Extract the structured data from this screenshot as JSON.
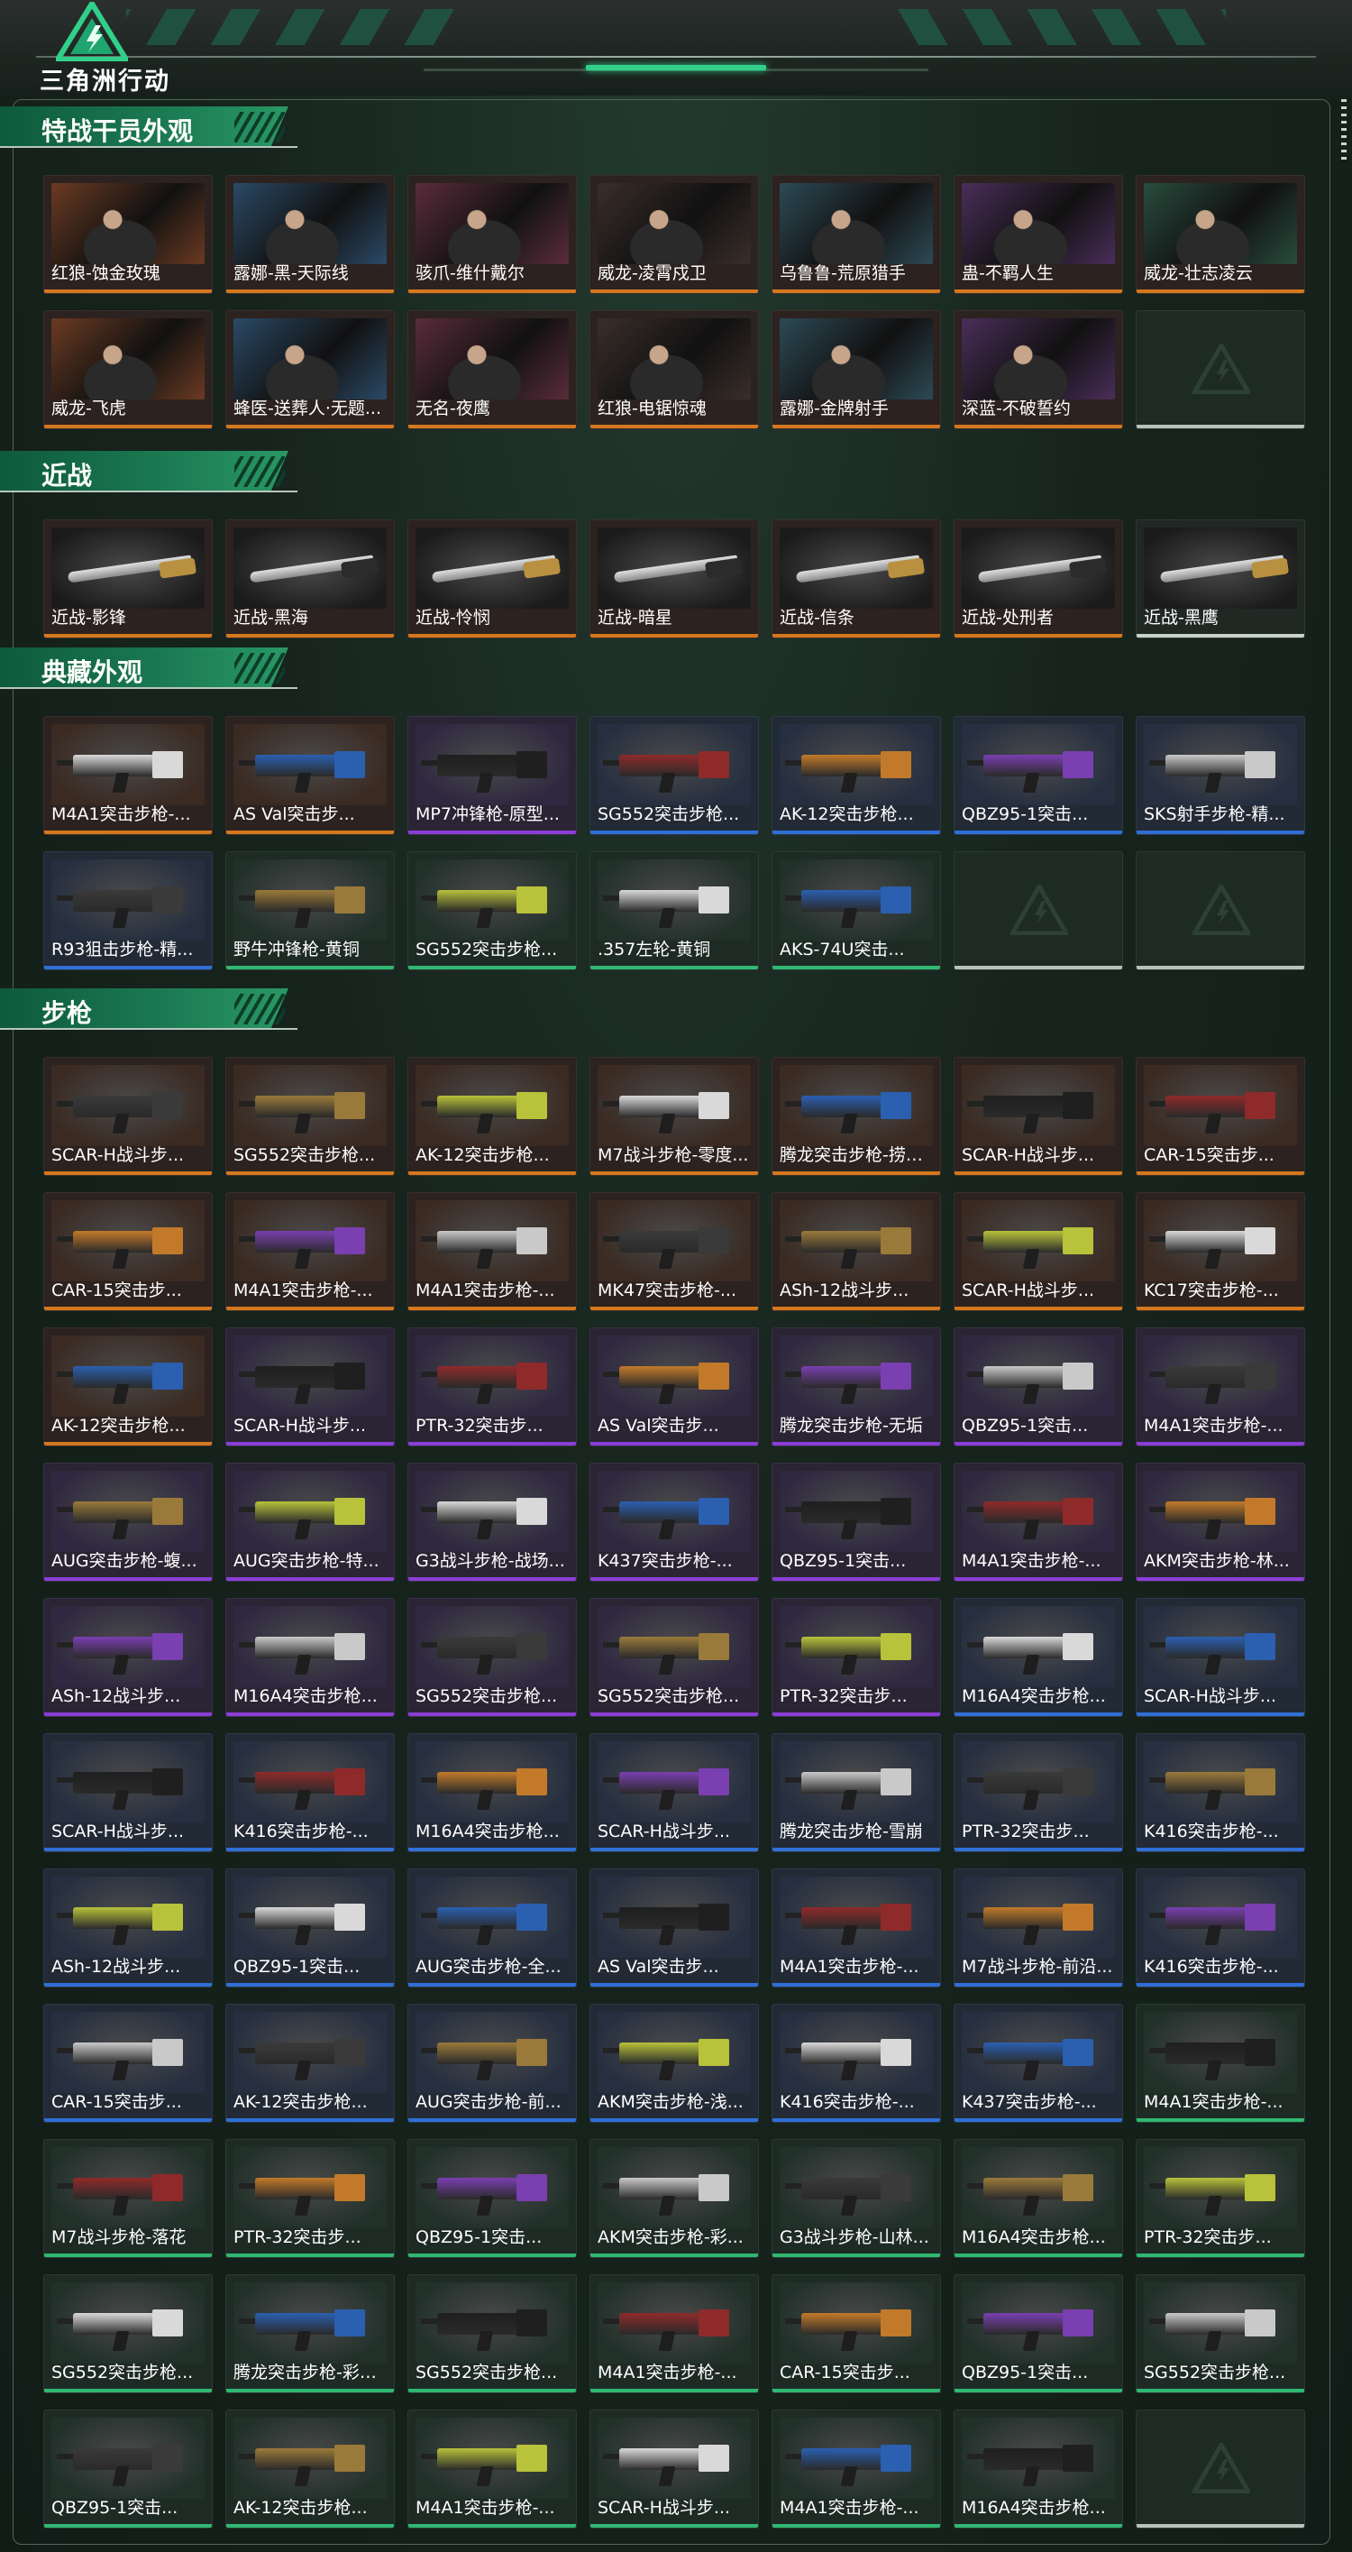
{
  "header": {
    "logo_text": "三角洲行动"
  },
  "colors": {
    "gold": "#d4781e",
    "purple": "#8a3ed6",
    "blue": "#2f6fd6",
    "green": "#2fb872",
    "white": "#c9d2cc",
    "accent": "#31d08a"
  },
  "sections": [
    {
      "title": "特战干员外观",
      "items": [
        {
          "label": "红狼-蚀金玫瑰",
          "tier": "gold"
        },
        {
          "label": "露娜-黑-天际线",
          "tier": "gold"
        },
        {
          "label": "骇爪-维什戴尔",
          "tier": "gold"
        },
        {
          "label": "威龙-凌霄戍卫",
          "tier": "gold"
        },
        {
          "label": "乌鲁鲁-荒原猎手",
          "tier": "gold"
        },
        {
          "label": "蛊-不羁人生",
          "tier": "gold"
        },
        {
          "label": "威龙-壮志凌云",
          "tier": "gold"
        },
        {
          "label": "威龙-飞虎",
          "tier": "gold"
        },
        {
          "label": "蜂医-送葬人·无题...",
          "tier": "gold"
        },
        {
          "label": "无名-夜鹰",
          "tier": "gold"
        },
        {
          "label": "红狼-电锯惊魂",
          "tier": "gold"
        },
        {
          "label": "露娜-金牌射手",
          "tier": "gold"
        },
        {
          "label": "深蓝-不破誓约",
          "tier": "gold"
        },
        {
          "label": "",
          "tier": "empty"
        }
      ]
    },
    {
      "title": "近战",
      "items": [
        {
          "label": "近战-影锋",
          "tier": "gold"
        },
        {
          "label": "近战-黑海",
          "tier": "gold"
        },
        {
          "label": "近战-怜悯",
          "tier": "gold"
        },
        {
          "label": "近战-暗星",
          "tier": "gold"
        },
        {
          "label": "近战-信条",
          "tier": "gold"
        },
        {
          "label": "近战-处刑者",
          "tier": "gold"
        },
        {
          "label": "近战-黑鹰",
          "tier": "white"
        }
      ]
    },
    {
      "title": "典藏外观",
      "items": [
        {
          "label": "M4A1突击步枪-...",
          "tier": "gold"
        },
        {
          "label": "AS Val突击步...",
          "tier": "gold"
        },
        {
          "label": "MP7冲锋枪-原型...",
          "tier": "purple"
        },
        {
          "label": "SG552突击步枪...",
          "tier": "blue"
        },
        {
          "label": "AK-12突击步枪...",
          "tier": "blue"
        },
        {
          "label": "QBZ95-1突击...",
          "tier": "blue"
        },
        {
          "label": "SKS射手步枪-精...",
          "tier": "blue"
        },
        {
          "label": "R93狙击步枪-精...",
          "tier": "blue"
        },
        {
          "label": "野牛冲锋枪-黄铜",
          "tier": "green"
        },
        {
          "label": "SG552突击步枪...",
          "tier": "green"
        },
        {
          "label": ".357左轮-黄铜",
          "tier": "green"
        },
        {
          "label": "AKS-74U突击...",
          "tier": "green"
        },
        {
          "label": "",
          "tier": "empty"
        },
        {
          "label": "",
          "tier": "empty"
        }
      ]
    },
    {
      "title": "步枪",
      "items": [
        {
          "label": "SCAR-H战斗步...",
          "tier": "gold"
        },
        {
          "label": "SG552突击步枪...",
          "tier": "gold"
        },
        {
          "label": "AK-12突击步枪...",
          "tier": "gold"
        },
        {
          "label": "M7战斗步枪-零度...",
          "tier": "gold"
        },
        {
          "label": "腾龙突击步枪-捞点...",
          "tier": "gold"
        },
        {
          "label": "SCAR-H战斗步...",
          "tier": "gold"
        },
        {
          "label": "CAR-15突击步...",
          "tier": "gold"
        },
        {
          "label": "CAR-15突击步...",
          "tier": "gold"
        },
        {
          "label": "M4A1突击步枪-...",
          "tier": "gold"
        },
        {
          "label": "M4A1突击步枪-...",
          "tier": "gold"
        },
        {
          "label": "MK47突击步枪-...",
          "tier": "gold"
        },
        {
          "label": "ASh-12战斗步...",
          "tier": "gold"
        },
        {
          "label": "SCAR-H战斗步...",
          "tier": "gold"
        },
        {
          "label": "KC17突击步枪-...",
          "tier": "gold"
        },
        {
          "label": "AK-12突击步枪...",
          "tier": "gold"
        },
        {
          "label": "SCAR-H战斗步...",
          "tier": "purple"
        },
        {
          "label": "PTR-32突击步...",
          "tier": "purple"
        },
        {
          "label": "AS Val突击步...",
          "tier": "purple"
        },
        {
          "label": "腾龙突击步枪-无垢",
          "tier": "purple"
        },
        {
          "label": "QBZ95-1突击...",
          "tier": "purple"
        },
        {
          "label": "M4A1突击步枪-...",
          "tier": "purple"
        },
        {
          "label": "AUG突击步枪-蝮...",
          "tier": "purple"
        },
        {
          "label": "AUG突击步枪-特...",
          "tier": "purple"
        },
        {
          "label": "G3战斗步枪-战场...",
          "tier": "purple"
        },
        {
          "label": "K437突击步枪-...",
          "tier": "purple"
        },
        {
          "label": "QBZ95-1突击...",
          "tier": "purple"
        },
        {
          "label": "M4A1突击步枪-...",
          "tier": "purple"
        },
        {
          "label": "AKM突击步枪-林...",
          "tier": "purple"
        },
        {
          "label": "ASh-12战斗步...",
          "tier": "purple"
        },
        {
          "label": "M16A4突击步枪...",
          "tier": "purple"
        },
        {
          "label": "SG552突击步枪...",
          "tier": "purple"
        },
        {
          "label": "SG552突击步枪...",
          "tier": "purple"
        },
        {
          "label": "PTR-32突击步...",
          "tier": "purple"
        },
        {
          "label": "M16A4突击步枪...",
          "tier": "blue"
        },
        {
          "label": "SCAR-H战斗步...",
          "tier": "blue"
        },
        {
          "label": "SCAR-H战斗步...",
          "tier": "blue"
        },
        {
          "label": "K416突击步枪-...",
          "tier": "blue"
        },
        {
          "label": "M16A4突击步枪...",
          "tier": "blue"
        },
        {
          "label": "SCAR-H战斗步...",
          "tier": "blue"
        },
        {
          "label": "腾龙突击步枪-雪崩",
          "tier": "blue"
        },
        {
          "label": "PTR-32突击步...",
          "tier": "blue"
        },
        {
          "label": "K416突击步枪-...",
          "tier": "blue"
        },
        {
          "label": "ASh-12战斗步...",
          "tier": "blue"
        },
        {
          "label": "QBZ95-1突击...",
          "tier": "blue"
        },
        {
          "label": "AUG突击步枪-全...",
          "tier": "blue"
        },
        {
          "label": "AS Val突击步...",
          "tier": "blue"
        },
        {
          "label": "M4A1突击步枪-...",
          "tier": "blue"
        },
        {
          "label": "M7战斗步枪-前沿...",
          "tier": "blue"
        },
        {
          "label": "K416突击步枪-...",
          "tier": "blue"
        },
        {
          "label": "CAR-15突击步...",
          "tier": "blue"
        },
        {
          "label": "AK-12突击步枪...",
          "tier": "blue"
        },
        {
          "label": "AUG突击步枪-前...",
          "tier": "blue"
        },
        {
          "label": "AKM突击步枪-浅...",
          "tier": "blue"
        },
        {
          "label": "K416突击步枪-...",
          "tier": "blue"
        },
        {
          "label": "K437突击步枪-...",
          "tier": "blue"
        },
        {
          "label": "M4A1突击步枪-...",
          "tier": "green"
        },
        {
          "label": "M7战斗步枪-落花",
          "tier": "green"
        },
        {
          "label": "PTR-32突击步...",
          "tier": "green"
        },
        {
          "label": "QBZ95-1突击...",
          "tier": "green"
        },
        {
          "label": "AKM突击步枪-彩...",
          "tier": "green"
        },
        {
          "label": "G3战斗步枪-山林...",
          "tier": "green"
        },
        {
          "label": "M16A4突击步枪...",
          "tier": "green"
        },
        {
          "label": "PTR-32突击步...",
          "tier": "green"
        },
        {
          "label": "SG552突击步枪...",
          "tier": "green"
        },
        {
          "label": "腾龙突击步枪-彩墨...",
          "tier": "green"
        },
        {
          "label": "SG552突击步枪...",
          "tier": "green"
        },
        {
          "label": "M4A1突击步枪-...",
          "tier": "green"
        },
        {
          "label": "CAR-15突击步...",
          "tier": "green"
        },
        {
          "label": "QBZ95-1突击...",
          "tier": "green"
        },
        {
          "label": "SG552突击步枪...",
          "tier": "green"
        },
        {
          "label": "QBZ95-1突击...",
          "tier": "green"
        },
        {
          "label": "AK-12突击步枪...",
          "tier": "green"
        },
        {
          "label": "M4A1突击步枪-...",
          "tier": "green"
        },
        {
          "label": "SCAR-H战斗步...",
          "tier": "green"
        },
        {
          "label": "M4A1突击步枪-...",
          "tier": "green"
        },
        {
          "label": "M16A4突击步枪...",
          "tier": "green"
        },
        {
          "label": "",
          "tier": "empty"
        }
      ]
    }
  ]
}
